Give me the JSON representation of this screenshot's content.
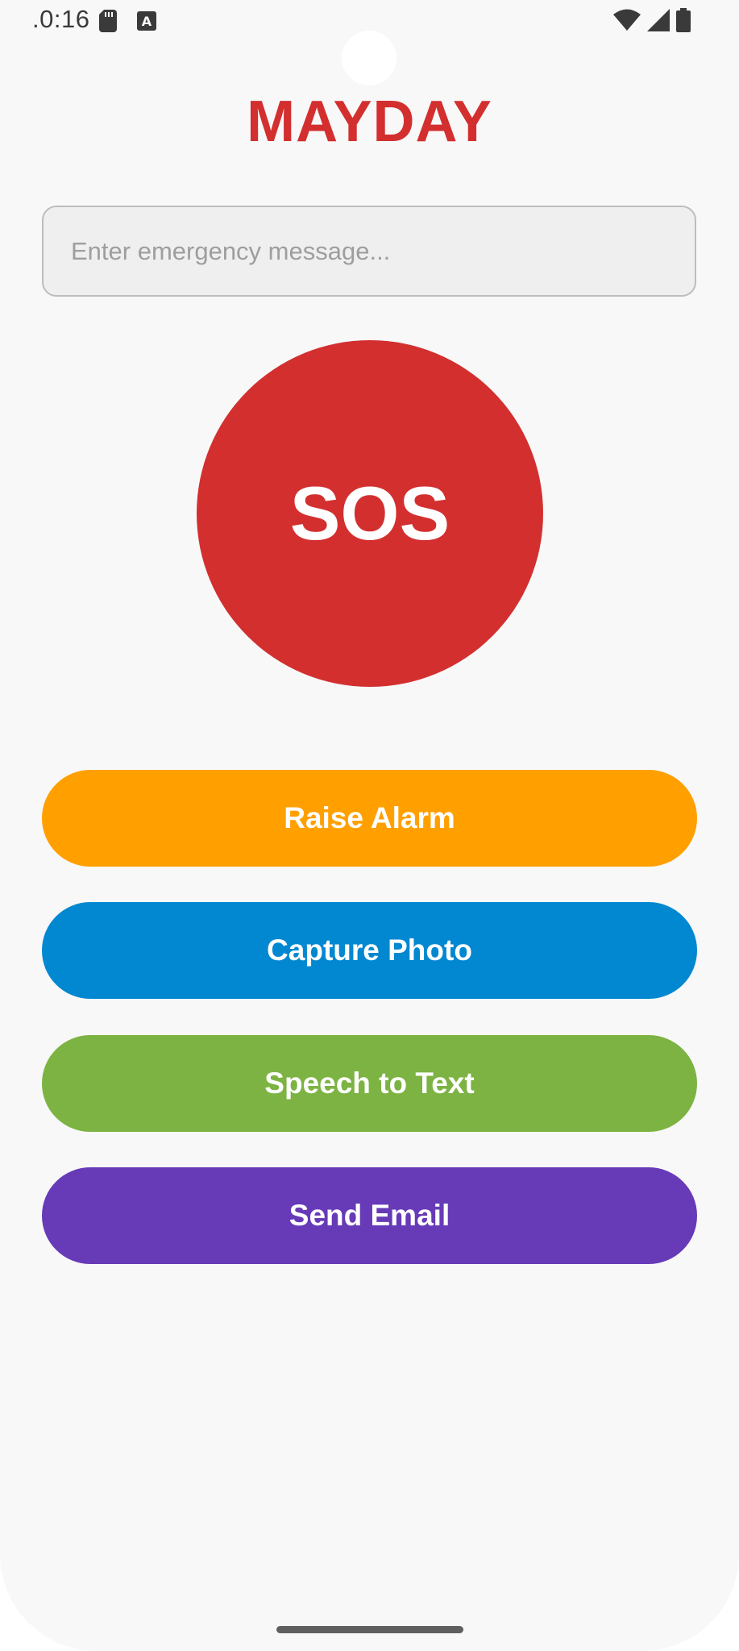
{
  "status_bar": {
    "time": ".0:16",
    "icons": [
      "sd-card-icon",
      "a-notification-icon",
      "wifi-icon",
      "signal-icon",
      "battery-icon"
    ]
  },
  "app": {
    "title": "MAYDAY",
    "title_color": "#d32f2f"
  },
  "message_input": {
    "placeholder": "Enter emergency message...",
    "value": ""
  },
  "sos_button": {
    "label": "SOS",
    "color": "#d32f2f"
  },
  "actions": {
    "raise_alarm": {
      "label": "Raise Alarm",
      "color": "#ffa000"
    },
    "capture_photo": {
      "label": "Capture Photo",
      "color": "#0288d1"
    },
    "speech_to_text": {
      "label": "Speech to Text",
      "color": "#7cb342"
    },
    "send_email": {
      "label": "Send Email",
      "color": "#673ab7"
    }
  }
}
